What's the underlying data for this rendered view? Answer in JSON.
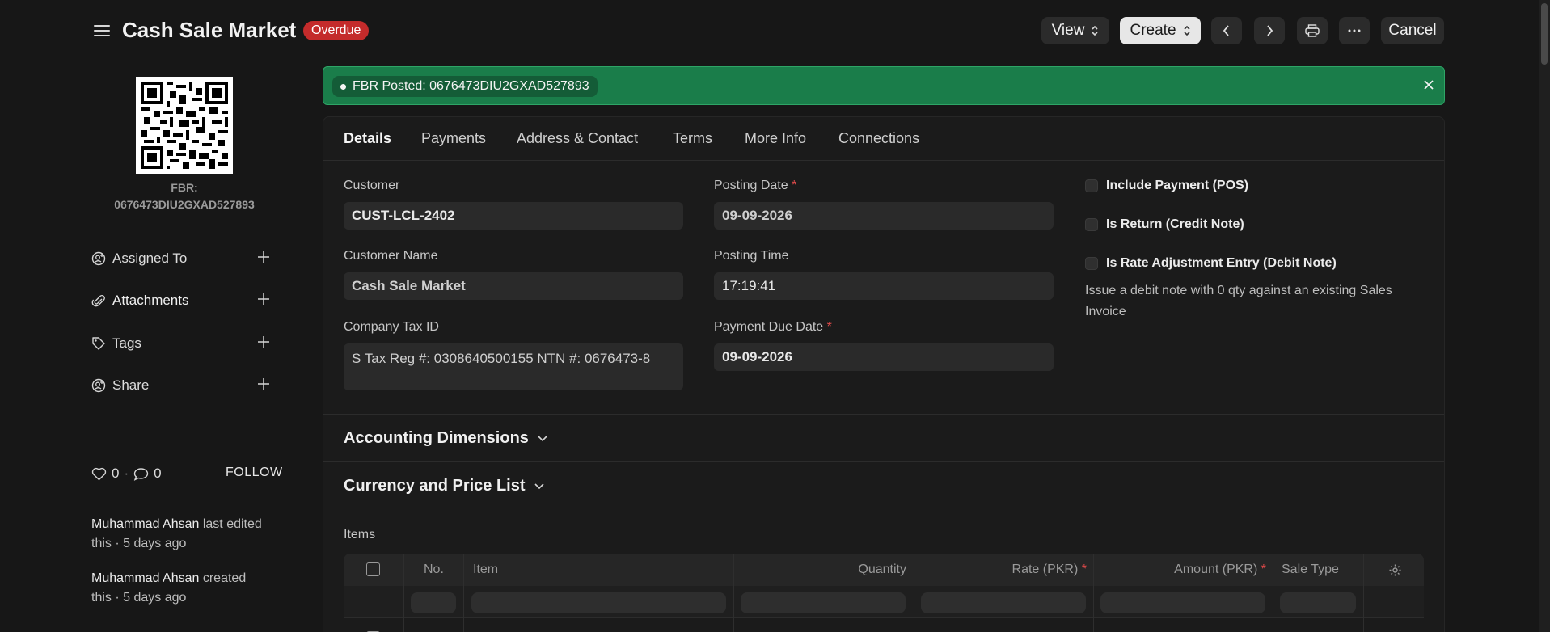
{
  "header": {
    "title": "Cash Sale Market",
    "status": "Overdue",
    "view_label": "View",
    "create_label": "Create",
    "cancel_label": "Cancel",
    "menu_icon": "hamburger-icon",
    "prev_icon": "chevron-left-icon",
    "next_icon": "chevron-right-icon",
    "print_icon": "printer-icon",
    "more_icon": "ellipsis-icon"
  },
  "sidebar": {
    "qr_caption_line1": "FBR:",
    "qr_caption_line2": "0676473DIU2GXAD527893",
    "items": [
      {
        "label": "Assigned To",
        "icon": "assign-user-icon"
      },
      {
        "label": "Attachments",
        "icon": "paperclip-icon"
      },
      {
        "label": "Tags",
        "icon": "tag-icon"
      },
      {
        "label": "Share",
        "icon": "share-user-icon"
      }
    ],
    "likes": "0",
    "comments": "0",
    "follow_label": "FOLLOW",
    "activity": [
      {
        "user": "Muhammad Ahsan",
        "action": " last edited",
        "when": "this · 5 days ago"
      },
      {
        "user": "Muhammad Ahsan",
        "action": " created",
        "when": "this · 5 days ago"
      }
    ]
  },
  "banner": {
    "text": "FBR Posted: 0676473DIU2GXAD527893",
    "color": "#1a7d4a"
  },
  "tabs": [
    "Details",
    "Payments",
    "Address & Contact",
    "Terms",
    "More Info",
    "Connections"
  ],
  "form": {
    "customer_label": "Customer",
    "customer_value": "CUST-LCL-2402",
    "customer_name_label": "Customer Name",
    "customer_name_value": "Cash Sale Market",
    "tax_id_label": "Company Tax ID",
    "tax_id_value": "S Tax Reg #: 0308640500155 NTN #: 0676473-8",
    "posting_date_label": "Posting Date",
    "posting_date_value": "09-09-2026",
    "posting_time_label": "Posting Time",
    "posting_time_value": "17:19:41",
    "due_date_label": "Payment Due Date",
    "due_date_value": "09-09-2026",
    "required_mark": "*",
    "checkboxes": [
      {
        "label": "Include Payment (POS)",
        "checked": false
      },
      {
        "label": "Is Return (Credit Note)",
        "checked": false
      },
      {
        "label": "Is Rate Adjustment Entry (Debit Note)",
        "checked": false
      }
    ],
    "debit_note_desc": "Issue a debit note with 0 qty against an existing Sales Invoice"
  },
  "sections": {
    "accounting": "Accounting Dimensions",
    "currency": "Currency and Price List"
  },
  "items_table": {
    "label": "Items",
    "columns": [
      "No.",
      "Item",
      "Quantity",
      "Rate (PKR)",
      "Amount (PKR)",
      "Sale Type"
    ],
    "settings_icon": "gear-icon"
  }
}
